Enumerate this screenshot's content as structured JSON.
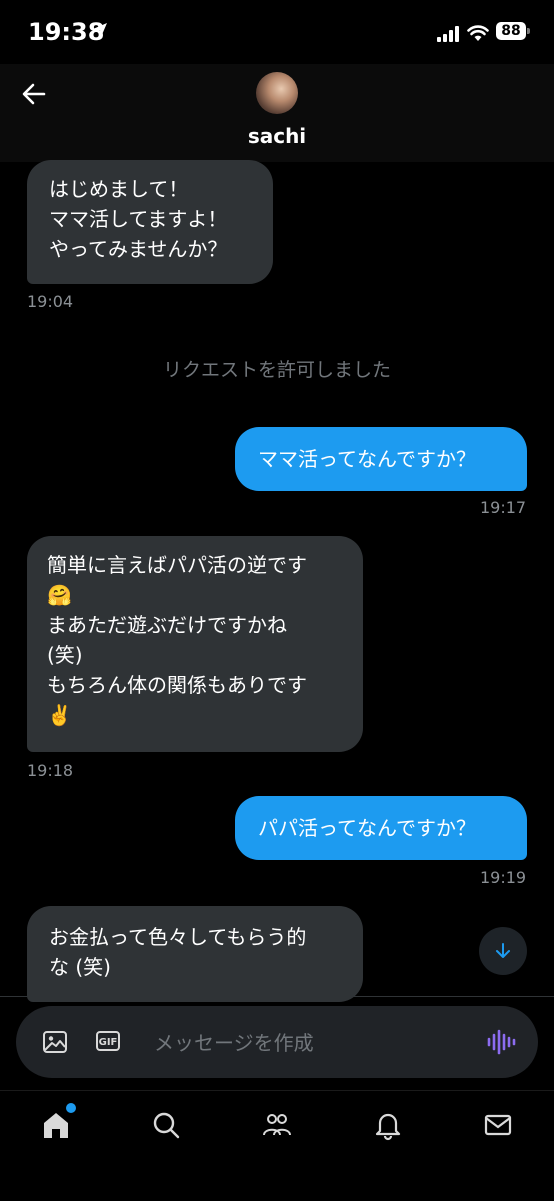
{
  "status_bar": {
    "time": "19:38",
    "battery": "88"
  },
  "header": {
    "username": "sachi"
  },
  "messages": [
    {
      "text": "はじめまして！\nママ活してますよ！\nやってみませんか？",
      "time": "19:04"
    },
    {
      "system": "リクエストを許可しました"
    },
    {
      "text": "ママ活ってなんですか？",
      "time": "19:17"
    },
    {
      "text": "簡単に言えばパパ活の逆です\n🤗\nまあただ遊ぶだけですかね\n(笑)\nもちろん体の関係もありです\n✌️",
      "time": "19:18"
    },
    {
      "text": "パパ活ってなんですか？",
      "time": "19:19"
    },
    {
      "text": "お金払って色々してもらう的\nな (笑)"
    }
  ],
  "composer": {
    "gif_label": "GIF",
    "placeholder": "メッセージを作成"
  },
  "icons": {
    "back": "arrow-left-icon",
    "image": "image-icon",
    "gif": "gif-icon",
    "voice": "voice-wave-icon",
    "scroll": "arrow-down-icon",
    "tabs": [
      "home-icon",
      "search-icon",
      "communities-icon",
      "bell-icon",
      "mail-icon"
    ]
  },
  "colors": {
    "accent": "#1d9bf0",
    "incoming_bubble": "#2f3336",
    "voice": "#8c6cf0"
  }
}
